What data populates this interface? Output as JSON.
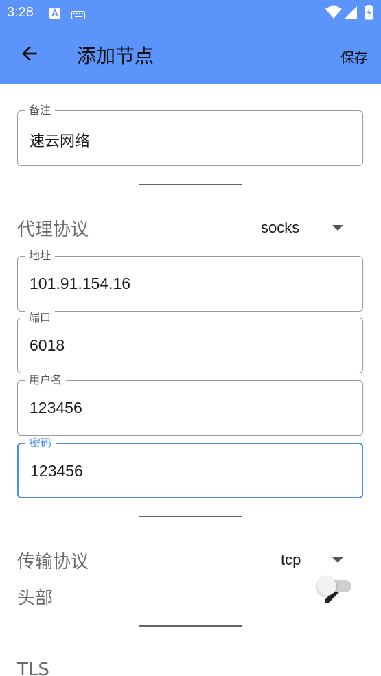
{
  "status_bar": {
    "time": "3:28"
  },
  "app_bar": {
    "title": "添加节点",
    "save_label": "保存"
  },
  "remark_field": {
    "label": "备注",
    "value": "速云网络"
  },
  "proxy_protocol": {
    "label": "代理协议",
    "selected": "socks"
  },
  "address_field": {
    "label": "地址",
    "value": "101.91.154.16"
  },
  "port_field": {
    "label": "端口",
    "value": "6018"
  },
  "username_field": {
    "label": "用户名",
    "value": "123456"
  },
  "password_field": {
    "label": "密码",
    "value": "123456"
  },
  "transport_protocol": {
    "label": "传输协议",
    "selected": "tcp"
  },
  "header_row": {
    "label": "头部"
  },
  "tls_row": {
    "label": "TLS",
    "enabled": false
  },
  "colors": {
    "accent": "#5b94fb",
    "focus": "#4a8df0"
  },
  "icons": [
    "back-arrow-icon",
    "edit-pencil-icon",
    "wifi-icon",
    "signal-icon",
    "battery-icon",
    "dropdown-caret-icon"
  ]
}
